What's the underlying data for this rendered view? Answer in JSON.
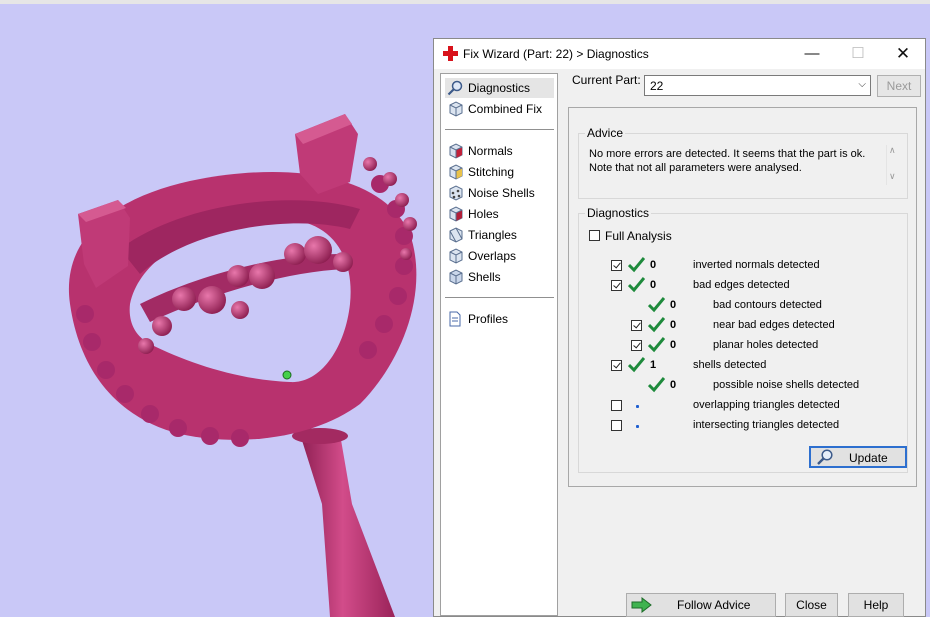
{
  "window": {
    "title": "Fix Wizard (Part: 22) > Diagnostics",
    "minimize_icon": "minimize-icon",
    "maximize_icon": "maximize-icon",
    "close_icon": "close-icon"
  },
  "nav": {
    "items": [
      {
        "label": "Diagnostics",
        "icon": "magnifier-icon",
        "selected": true
      },
      {
        "label": "Combined Fix",
        "icon": "cube-icon"
      },
      {
        "label": "Normals",
        "icon": "normals-cube-icon"
      },
      {
        "label": "Stitching",
        "icon": "stitching-cube-icon"
      },
      {
        "label": "Noise Shells",
        "icon": "noise-shells-icon"
      },
      {
        "label": "Holes",
        "icon": "holes-cube-icon"
      },
      {
        "label": "Triangles",
        "icon": "triangles-cube-icon"
      },
      {
        "label": "Overlaps",
        "icon": "overlaps-cube-icon"
      },
      {
        "label": "Shells",
        "icon": "shells-cube-icon"
      },
      {
        "label": "Profiles",
        "icon": "document-icon"
      }
    ]
  },
  "current_part": {
    "label": "Current Part:",
    "value": "22",
    "next_label": "Next"
  },
  "advice": {
    "title": "Advice",
    "text_line1": "No more errors are detected. It seems that the part is ok.",
    "text_line2": "Note that not all parameters were analysed."
  },
  "diagnostics": {
    "title": "Diagnostics",
    "full_analysis_label": "Full Analysis",
    "full_analysis_checked": false,
    "rows": [
      {
        "checked": true,
        "count": "0",
        "label": "inverted normals detected"
      },
      {
        "checked": true,
        "count": "0",
        "label": "bad edges detected"
      },
      {
        "count": "0",
        "label": "bad contours detected"
      },
      {
        "checked": true,
        "count": "0",
        "label": "near bad edges detected"
      },
      {
        "checked": true,
        "count": "0",
        "label": "planar holes detected"
      },
      {
        "checked": true,
        "count": "1",
        "label": "shells detected"
      },
      {
        "count": "0",
        "label": "possible noise shells detected"
      },
      {
        "checked": false,
        "label": "overlapping triangles detected"
      },
      {
        "checked": false,
        "label": "intersecting triangles detected"
      }
    ],
    "update_label": "Update"
  },
  "footer": {
    "follow_advice_label": "Follow Advice",
    "close_label": "Close",
    "help_label": "Help"
  },
  "colors": {
    "viewport_background": "#c9c8f7",
    "model": "#b8326e",
    "tick_green": "#1e8a3c",
    "focus_blue": "#2d6fcf"
  }
}
